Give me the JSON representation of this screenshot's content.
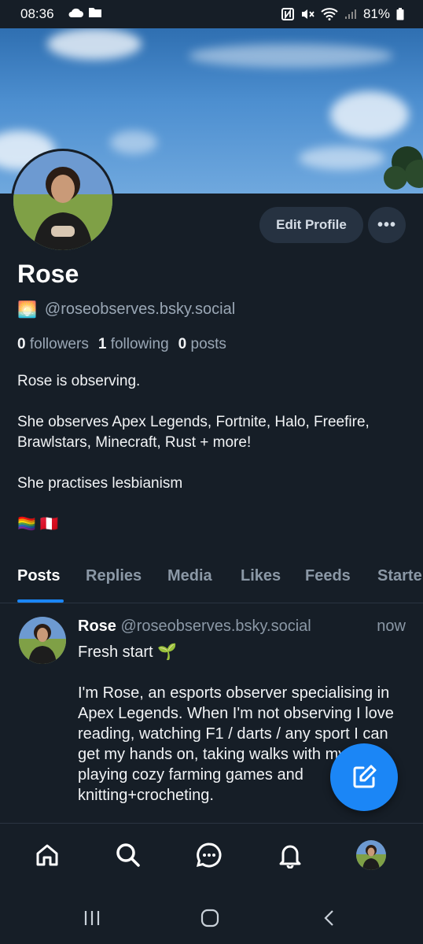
{
  "status": {
    "time": "08:36",
    "battery": "81%",
    "icons_left": [
      "cloud-icon",
      "folder-icon"
    ],
    "icons_right": [
      "nfc-icon",
      "mute-icon",
      "wifi-icon",
      "signal-icon",
      "battery-icon"
    ]
  },
  "profile": {
    "name": "Rose",
    "emoji": "🌅",
    "handle": "@roseobserves.bsky.social",
    "followers_count": "0",
    "followers_label": "followers",
    "following_count": "1",
    "following_label": "following",
    "posts_count": "0",
    "posts_label": "posts",
    "bio": "Rose is observing.\n\nShe observes Apex Legends, Fortnite, Halo, Freefire, Brawlstars, Minecraft, Rust + more!\n\nShe practises lesbianism\n\n🏳️‍🌈 🇵🇪"
  },
  "actions": {
    "edit_profile": "Edit Profile",
    "more": "•••"
  },
  "tabs": [
    {
      "label": "Posts",
      "active": true
    },
    {
      "label": "Replies",
      "active": false
    },
    {
      "label": "Media",
      "active": false
    },
    {
      "label": "Likes",
      "active": false
    },
    {
      "label": "Feeds",
      "active": false
    },
    {
      "label": "Starter Packs",
      "active": false
    }
  ],
  "post": {
    "author": "Rose",
    "handle": "@roseobserves.bsky.social",
    "time": "now",
    "text": "Fresh start 🌱\n\nI'm Rose, an esports observer specialising in Apex Legends. When I'm not observing I love reading, watching F1 / darts / any sport I can get my hands on, taking walks with my gf, playing cozy farming games and knitting+crocheting."
  },
  "nav": [
    "home-icon",
    "search-icon",
    "chat-icon",
    "bell-icon",
    "profile-avatar"
  ],
  "colors": {
    "background": "#161e27",
    "accent": "#1b86f6",
    "muted_text": "#8b98a6",
    "button_bg": "#263241"
  }
}
